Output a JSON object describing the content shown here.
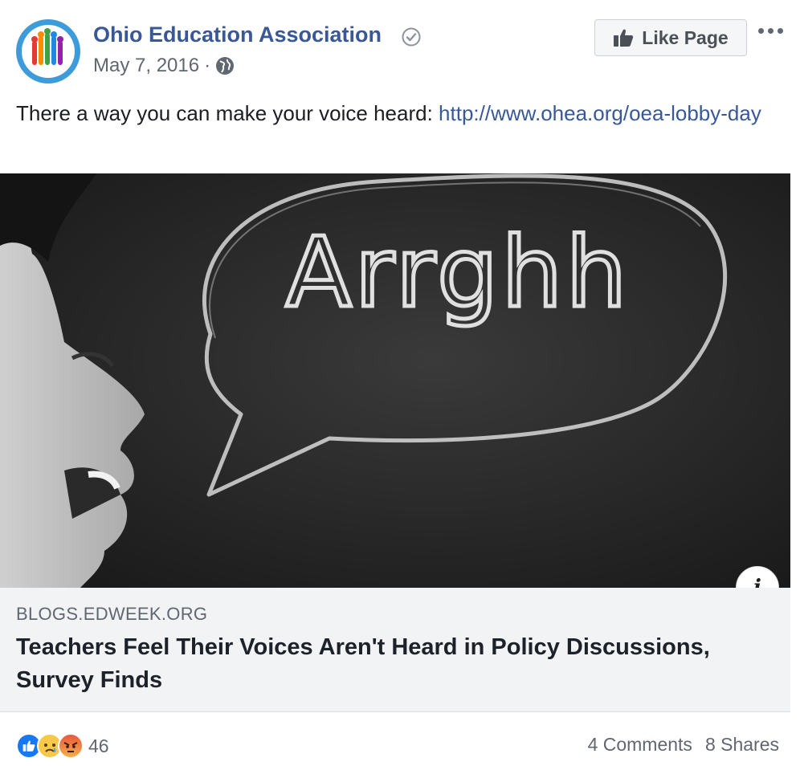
{
  "post": {
    "page_name": "Ohio Education Association",
    "date": "May 7, 2016",
    "separator": "·",
    "privacy_icon": "globe-icon",
    "like_button_label": "Like Page",
    "text": "There a way you can make your voice heard: ",
    "link_text": "http://www.ohea.org/oea-lobby-day"
  },
  "image": {
    "chalk_text": "Arrghh"
  },
  "link_card": {
    "domain": "BLOGS.EDWEEK.ORG",
    "title": "Teachers Feel Their Voices Aren't Heard in Policy Discussions, Survey Finds",
    "info_label": "i"
  },
  "footer": {
    "reaction_count": "46",
    "comments": "4 Comments",
    "shares": "8 Shares"
  },
  "colors": {
    "link": "#385898",
    "avatar_ring": "#3d9bd9",
    "like_reaction": "#1877f2",
    "sad_reaction": "#f7c84a",
    "angry_reaction": "#e9573f"
  }
}
